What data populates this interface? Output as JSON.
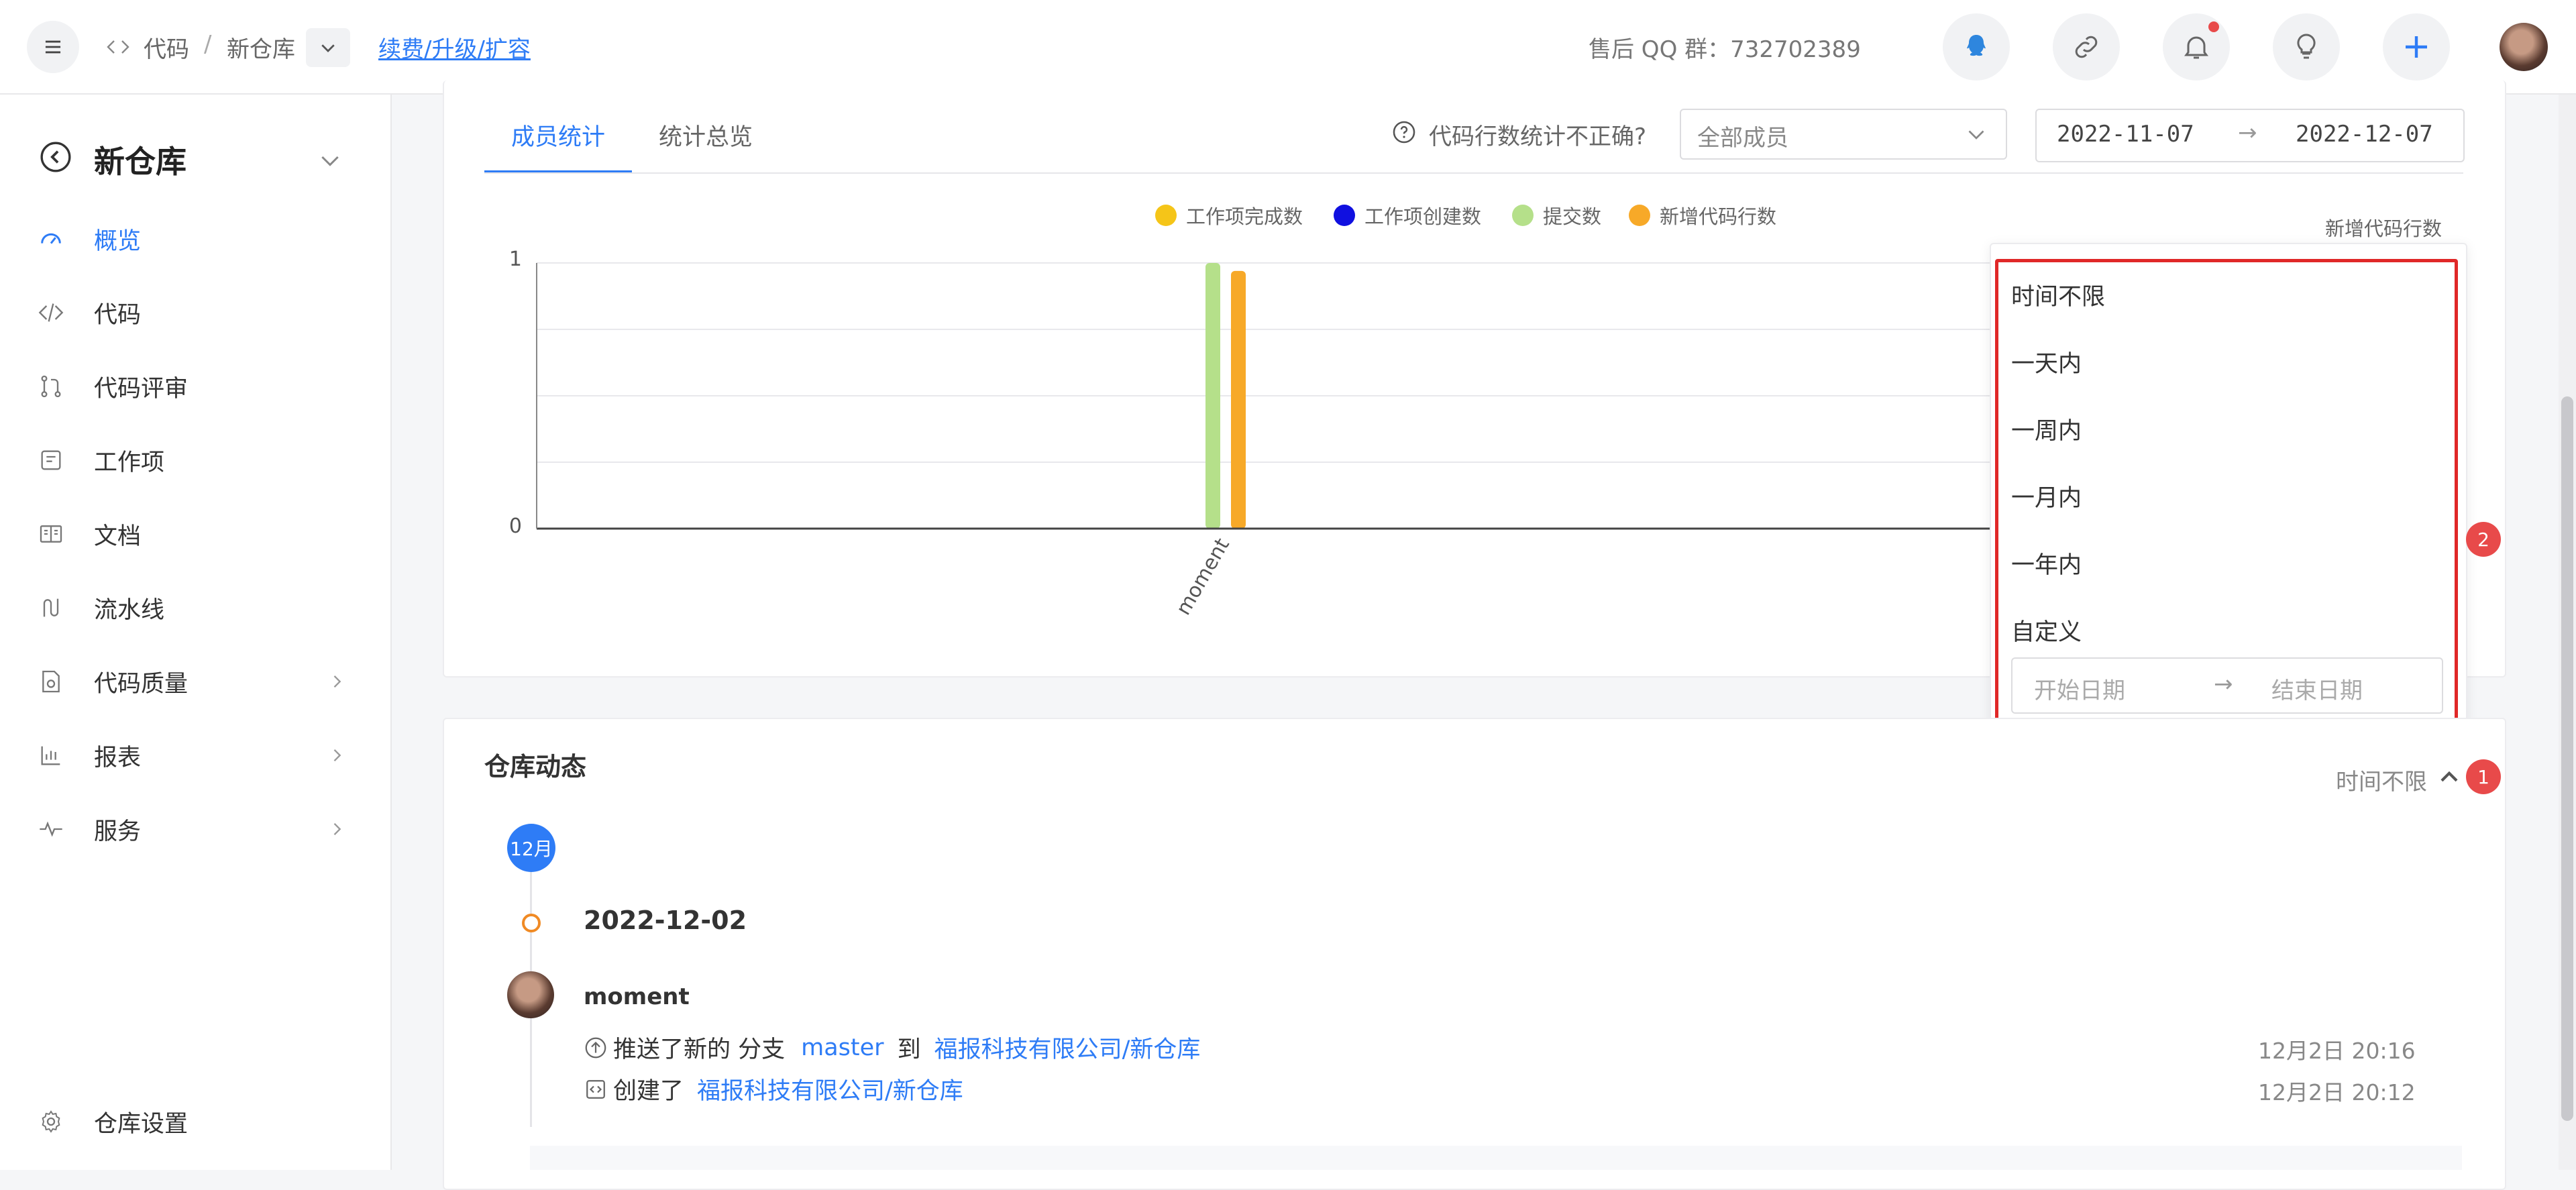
{
  "topbar": {
    "breadcrumb_code": "代码",
    "breadcrumb_sep": "/",
    "breadcrumb_repo": "新仓库",
    "renew_link": "续费/升级/扩容",
    "qq_group": "售后 QQ 群：732702389"
  },
  "sidebar": {
    "repo_name": "新仓库",
    "items": [
      {
        "label": "概览",
        "icon": "dashboard-icon"
      },
      {
        "label": "代码",
        "icon": "code-icon"
      },
      {
        "label": "代码评审",
        "icon": "merge-request-icon"
      },
      {
        "label": "工作项",
        "icon": "work-item-icon"
      },
      {
        "label": "文档",
        "icon": "document-icon"
      },
      {
        "label": "流水线",
        "icon": "pipeline-icon"
      },
      {
        "label": "代码质量",
        "icon": "quality-icon"
      },
      {
        "label": "报表",
        "icon": "report-icon"
      },
      {
        "label": "服务",
        "icon": "service-icon"
      }
    ],
    "settings": "仓库设置"
  },
  "stats": {
    "tabs": [
      "成员统计",
      "统计总览"
    ],
    "help_text": "代码行数统计不正确?",
    "member_select": "全部成员",
    "date_start": "2022-11-07",
    "date_arrow": "→",
    "date_end": "2022-12-07"
  },
  "chart_data": {
    "type": "bar",
    "legend": [
      "工作项完成数",
      "工作项创建数",
      "提交数",
      "新增代码行数"
    ],
    "categories": [
      "moment"
    ],
    "series": [
      {
        "name": "工作项完成数",
        "values": [
          0
        ],
        "color": "#f5c518"
      },
      {
        "name": "工作项创建数",
        "values": [
          0
        ],
        "color": "#1010e0"
      },
      {
        "name": "提交数",
        "values": [
          1
        ],
        "color": "#b5e08a"
      },
      {
        "name": "新增代码行数",
        "values": [
          0.97
        ],
        "color": "#f7a928"
      }
    ],
    "y_ticks": [
      "1",
      "0"
    ],
    "ylim": [
      0,
      1
    ],
    "right_axis_label": "新增代码行数"
  },
  "dropdown": {
    "items": [
      "时间不限",
      "一天内",
      "一周内",
      "一月内",
      "一年内",
      "自定义"
    ],
    "start_placeholder": "开始日期",
    "arrow": "→",
    "end_placeholder": "结束日期"
  },
  "activity": {
    "title": "仓库动态",
    "filter_label": "时间不限",
    "badge_1": "1",
    "badge_2": "2",
    "month": "12月",
    "date": "2022-12-02",
    "user": "moment",
    "row1": {
      "action": "推送了新的 分支",
      "branch": "master",
      "to": "到",
      "repo": "福报科技有限公司/新仓库",
      "time": "12月2日 20:16"
    },
    "row2": {
      "action": "创建了",
      "repo": "福报科技有限公司/新仓库",
      "time": "12月2日 20:12"
    }
  },
  "colors": {
    "accent": "#2e7cf6",
    "highlight": "#e02828"
  }
}
